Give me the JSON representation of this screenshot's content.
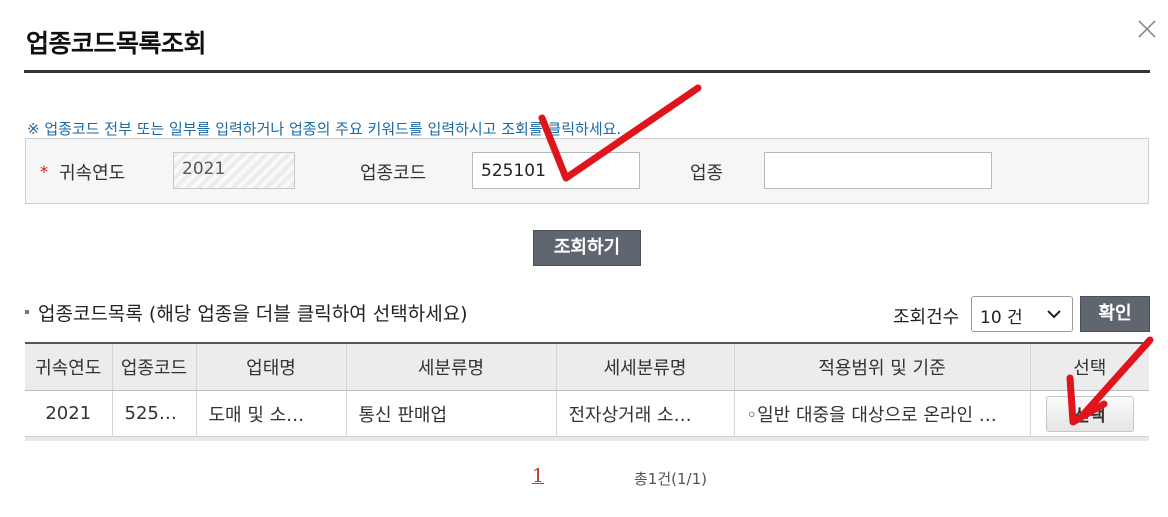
{
  "dialog": {
    "title": "업종코드목록조회"
  },
  "notice": "※ 업종코드 전부 또는 일부를 입력하거나 업종의 주요 키워드를 입력하시고 조회를 클릭하세요.",
  "search": {
    "required_mark": "*",
    "year_label": "귀속연도",
    "year_value": "2021",
    "code_label": "업종코드",
    "code_value": "525101",
    "industry_label": "업종",
    "industry_value": "",
    "search_button": "조회하기"
  },
  "list": {
    "title": "업종코드목록 (해당 업종을 더블 클릭하여 선택하세요)",
    "count_label": "조회건수",
    "count_value": "10 건",
    "confirm_button": "확인"
  },
  "table": {
    "headers": [
      "귀속연도",
      "업종코드",
      "업태명",
      "세분류명",
      "세세분류명",
      "적용범위 및 기준",
      "선택"
    ],
    "rows": [
      {
        "year": "2021",
        "code": "525…",
        "business_type": "도매 및 소…",
        "sub_category": "통신 판매업",
        "detail_category": "전자상거래 소…",
        "scope": "◦일반 대중을 대상으로 온라인 …",
        "select_label": "선택"
      }
    ]
  },
  "pagination": {
    "current_page": "1",
    "summary": "총1건(1/1)"
  },
  "colors": {
    "annotation": "#e0151b",
    "notice": "#1a6aa6",
    "button_dark": "#5f6670",
    "page_link": "#c0392b"
  }
}
